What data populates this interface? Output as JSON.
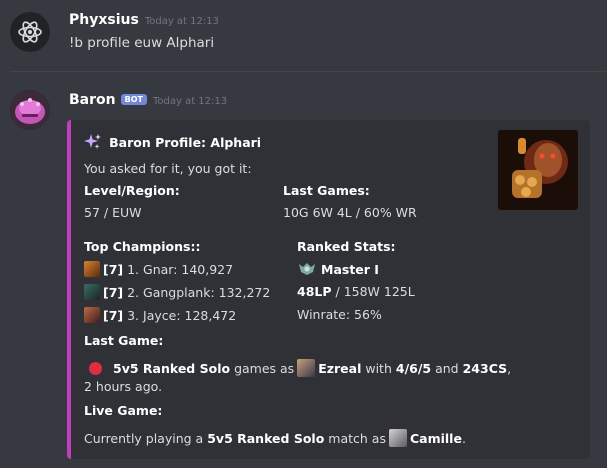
{
  "messages": [
    {
      "author": "Phyxsius",
      "timestamp": "Today at 12:13",
      "text": "!b profile euw Alphari"
    },
    {
      "author": "Baron",
      "bot_tag": "BOT",
      "timestamp": "Today at 12:13"
    }
  ],
  "embed": {
    "title": "Baron Profile: Alphari",
    "description": "You asked for it, you got it:",
    "level_region": {
      "label": "Level/Region:",
      "value": "57 / EUW"
    },
    "last_games": {
      "label": "Last Games:",
      "value": "10G 6W 4L / 60% WR"
    },
    "top_champions": {
      "label": "Top Champions::",
      "items": [
        {
          "mastery": "[7]",
          "text": "1. Gnar: 140,927"
        },
        {
          "mastery": "[7]",
          "text": "2. Gangplank: 132,272"
        },
        {
          "mastery": "[7]",
          "text": "3. Jayce: 128,472"
        }
      ]
    },
    "ranked": {
      "label": "Ranked Stats:",
      "tier": "Master I",
      "lp": "48LP",
      "record": " / 158W 125L",
      "winrate": "Winrate: 56%"
    },
    "last_game": {
      "label": "Last Game:",
      "queue": "5v5 Ranked Solo",
      "games_as": "games as",
      "champion": "Ezreal",
      "with": "with",
      "kda": "4/6/5",
      "and": "and",
      "cs": "243CS",
      "comma": ",",
      "when": "2 hours ago."
    },
    "live_game": {
      "label": "Live Game:",
      "prefix": "Currently playing a",
      "queue": "5v5 Ranked Solo",
      "match_as": "match as",
      "champion": "Camille",
      "period": "."
    }
  },
  "colors": {
    "background": "#36393f",
    "embed_bg": "#2f3136",
    "embed_accent": "#c13fbf",
    "bot_tag": "#7289da",
    "status_red": "#dd2e44"
  }
}
